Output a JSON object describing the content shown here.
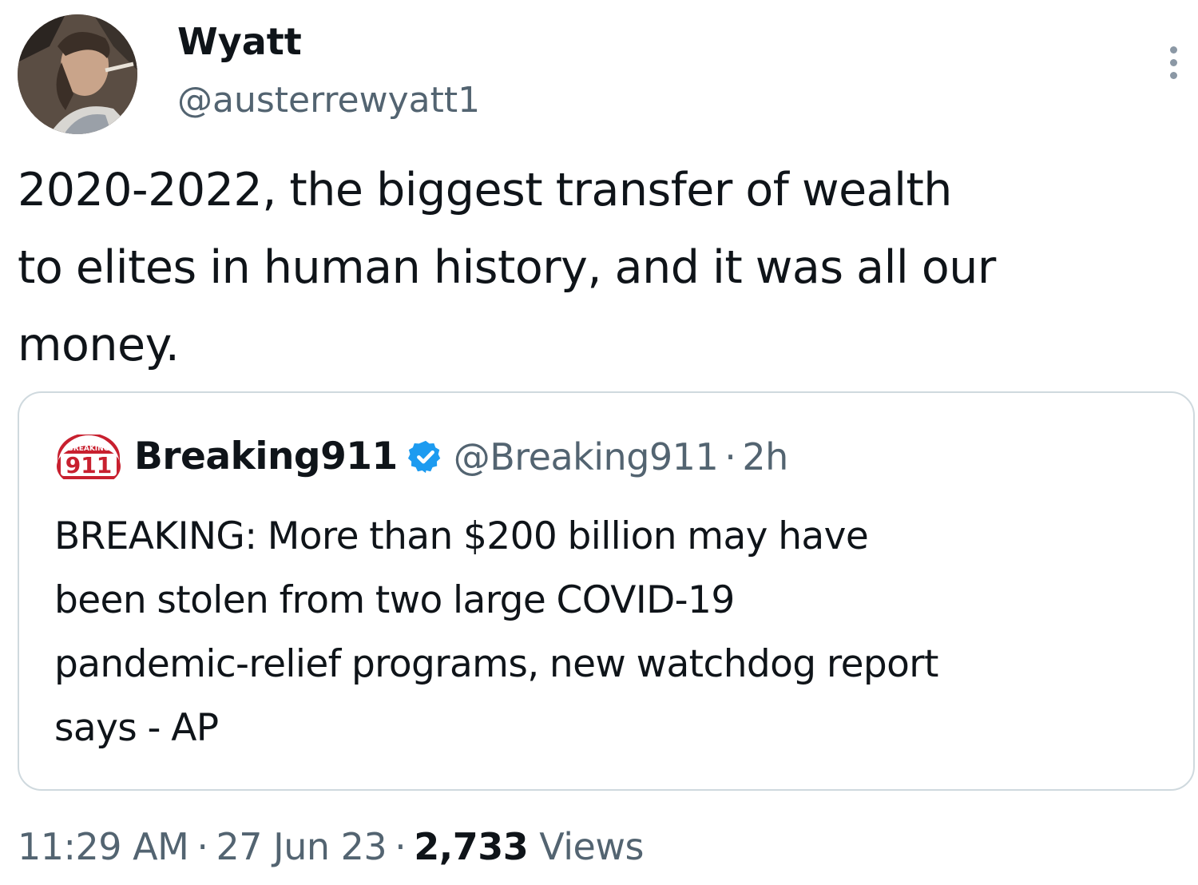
{
  "tweet": {
    "author": {
      "display_name": "Wyatt",
      "handle": "@austerrewyatt1",
      "avatar_icon": "profile-photo-man-smoking"
    },
    "more_icon": "vertical-ellipsis-icon",
    "text": "2020-2022, the biggest transfer of wealth\nto elites in human history, and it was all our\nmoney.",
    "quoted": {
      "avatar_icon": "breaking-911-logo",
      "avatar_text": "911",
      "avatar_small_text": "BREAKING",
      "display_name": "Breaking911",
      "verified_icon": "verified-badge-icon",
      "handle": "@Breaking911",
      "separator": "·",
      "time_ago": "2h",
      "text": "BREAKING: More than $200 billion may have\nbeen stolen from two large COVID-19\npandemic-relief programs, new watchdog report\nsays - AP"
    },
    "meta": {
      "time": "11:29 AM",
      "date": "27 Jun 23",
      "separator": "·",
      "views_count": "2,733",
      "views_label": "Views"
    }
  },
  "colors": {
    "text_primary": "#0f1419",
    "text_secondary": "#536471",
    "border": "#cfd9de",
    "verified_blue": "#1d9bf0",
    "logo_red": "#c8202f"
  }
}
